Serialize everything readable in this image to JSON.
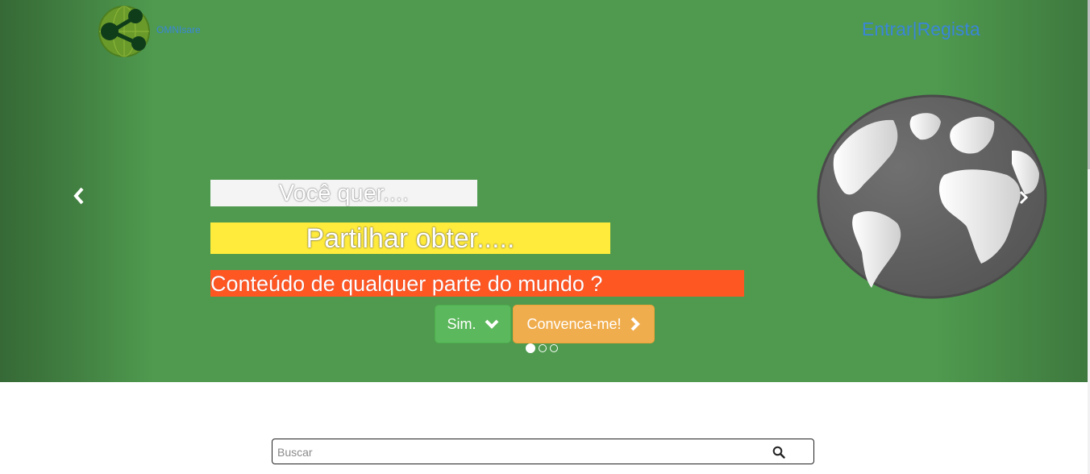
{
  "header": {
    "brand": "OMNIsare",
    "login_label": "Entrar",
    "separator": "|",
    "register_label": "Regista"
  },
  "carousel": {
    "line1": "Você quer....",
    "line2": "Partilhar obter.....",
    "line3": "Conteúdo de qualquer parte do mundo ?",
    "yes_button": "Sim.",
    "convince_button": "Convenca-me!",
    "slide_count": 3,
    "active_slide": 1
  },
  "search": {
    "placeholder": "Buscar"
  },
  "colors": {
    "hero_bg": "#4f9a4f",
    "line1_bg": "#f4f4f4",
    "line2_bg": "#ffeb3b",
    "line3_bg": "#ff5722",
    "yes_bg": "#5cb85c",
    "convince_bg": "#f0ad4e",
    "link": "#3a86d8"
  },
  "icons": {
    "logo": "share-network-globe-icon",
    "prev": "chevron-left-icon",
    "next": "chevron-right-icon",
    "yes": "chevron-down-icon",
    "convince": "chevron-right-icon",
    "search": "search-icon",
    "globe": "globe-image"
  }
}
